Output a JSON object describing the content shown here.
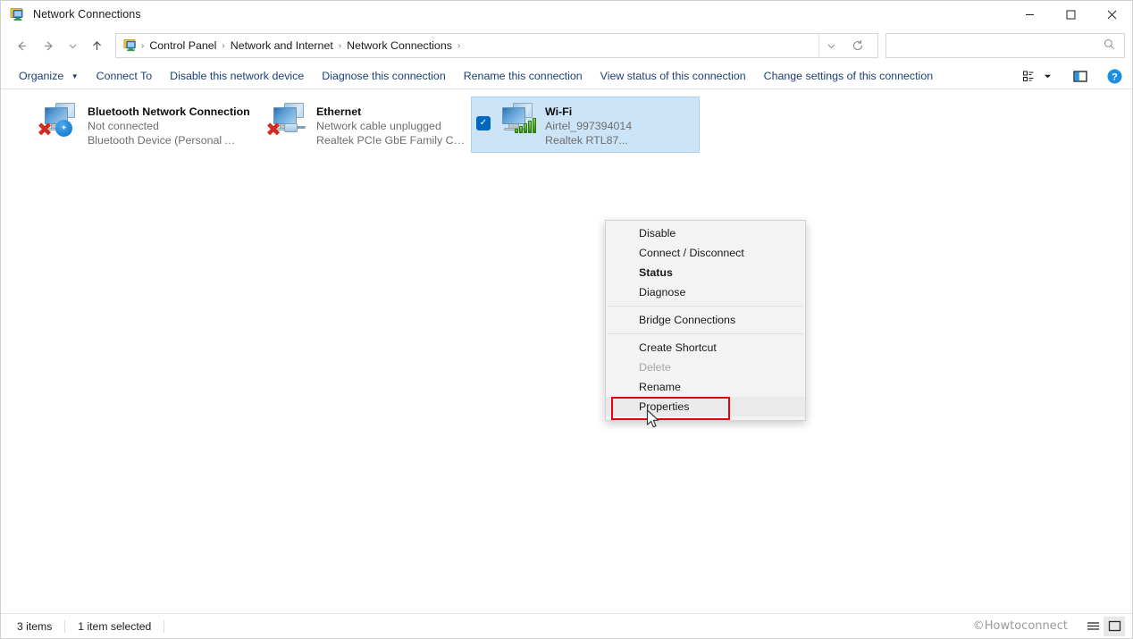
{
  "window": {
    "title": "Network Connections",
    "app_icon": "network-connections-icon",
    "controls": {
      "minimize": "—",
      "maximize": "☐",
      "close": "✕"
    }
  },
  "addressbar": {
    "back": "←",
    "forward": "→",
    "recent": "∨",
    "up": "↑",
    "breadcrumb_icon": "control-panel-icon",
    "crumbs": [
      "Control Panel",
      "Network and Internet",
      "Network Connections"
    ],
    "separator": "›",
    "dropdown": "∨",
    "refresh": "↻",
    "search": {
      "value": "",
      "placeholder": "",
      "icon": "search-icon"
    }
  },
  "commandbar": {
    "items": [
      {
        "label": "Organize",
        "has_caret": true
      },
      {
        "label": "Connect To",
        "has_caret": false
      },
      {
        "label": "Disable this network device",
        "has_caret": false
      },
      {
        "label": "Diagnose this connection",
        "has_caret": false
      },
      {
        "label": "Rename this connection",
        "has_caret": false
      },
      {
        "label": "View status of this connection",
        "has_caret": false
      },
      {
        "label": "Change settings of this connection",
        "has_caret": false
      }
    ],
    "caret": "▼",
    "right_icons": [
      {
        "name": "view-layout-icon",
        "glyph": "▤"
      },
      {
        "name": "chevron-down-icon",
        "glyph": "▼"
      },
      {
        "name": "details-pane-icon",
        "glyph": "◧"
      },
      {
        "name": "help-icon",
        "glyph": "?"
      }
    ]
  },
  "connections": [
    {
      "name": "Bluetooth Network Connection",
      "status": "Not connected",
      "device": "Bluetooth Device (Personal Ar...",
      "icon": "network-adapter-icon",
      "badge": "bluetooth-badge",
      "disconnected": true,
      "selected": false
    },
    {
      "name": "Ethernet",
      "status": "Network cable unplugged",
      "device": "Realtek PCIe GbE Family Cont...",
      "icon": "network-adapter-icon",
      "badge": "unplugged-badge",
      "disconnected": true,
      "selected": false
    },
    {
      "name": "Wi-Fi",
      "status": "Airtel_997394014",
      "device": "Realtek RTL87...",
      "icon": "network-adapter-icon",
      "badge": "wifi-signal-badge",
      "disconnected": false,
      "selected": true,
      "checkmark": "✓"
    }
  ],
  "context_menu": [
    {
      "label": "Disable",
      "icon": "shield-icon",
      "bold": false,
      "disabled": false,
      "highlight": false
    },
    {
      "label": "Connect / Disconnect",
      "icon": "",
      "bold": false,
      "disabled": false,
      "highlight": false
    },
    {
      "label": "Status",
      "icon": "",
      "bold": true,
      "disabled": false,
      "highlight": false
    },
    {
      "label": "Diagnose",
      "icon": "",
      "bold": false,
      "disabled": false,
      "highlight": false
    },
    {
      "separator": true
    },
    {
      "label": "Bridge Connections",
      "icon": "shield-icon",
      "bold": false,
      "disabled": false,
      "highlight": false
    },
    {
      "separator": true
    },
    {
      "label": "Create Shortcut",
      "icon": "",
      "bold": false,
      "disabled": false,
      "highlight": false
    },
    {
      "label": "Delete",
      "icon": "shield-icon",
      "bold": false,
      "disabled": true,
      "highlight": false
    },
    {
      "label": "Rename",
      "icon": "shield-icon",
      "bold": false,
      "disabled": false,
      "highlight": false
    },
    {
      "label": "Properties",
      "icon": "shield-icon",
      "bold": false,
      "disabled": false,
      "highlight": true
    }
  ],
  "statusbar": {
    "item_count": "3 items",
    "selection": "1 item selected",
    "watermark": "©Howtoconnect",
    "view_icons": [
      {
        "name": "details-view-icon",
        "glyph": "≡",
        "active": false
      },
      {
        "name": "large-icons-view-icon",
        "glyph": "□",
        "active": true
      }
    ]
  },
  "colors": {
    "selection_bg": "#cce4f7",
    "selection_border": "#a9d2f0",
    "highlight_red": "#e8000d",
    "link_blue": "#1c3f74",
    "accent_blue": "#0067c0",
    "menu_bg": "#f3f3f3"
  }
}
